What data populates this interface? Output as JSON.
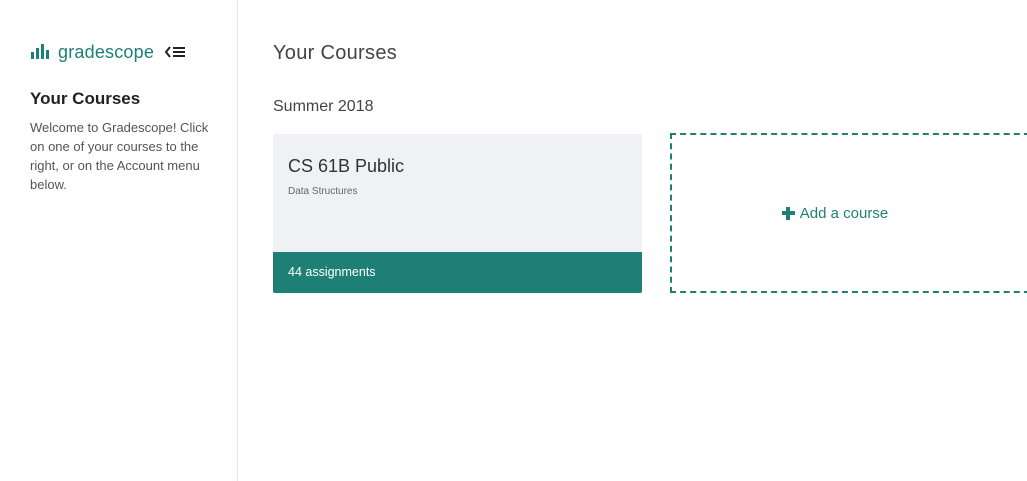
{
  "brand": {
    "name": "gradescope",
    "icon": "bar-chart-logo",
    "color": "#1e7f77"
  },
  "sidebar": {
    "title": "Your Courses",
    "description": "Welcome to Gradescope! Click on one of your courses to the right, or on the Account menu below.",
    "collapse_icon": "collapse-menu-icon"
  },
  "main": {
    "title": "Your Courses",
    "terms": [
      {
        "name": "Summer 2018",
        "courses": [
          {
            "name": "CS 61B Public",
            "description": "Data Structures",
            "assignments": "44 assignments"
          }
        ]
      }
    ],
    "add_course_label": "Add a course"
  },
  "colors": {
    "accent": "#1e7f77",
    "card_background": "#eff1f4"
  }
}
